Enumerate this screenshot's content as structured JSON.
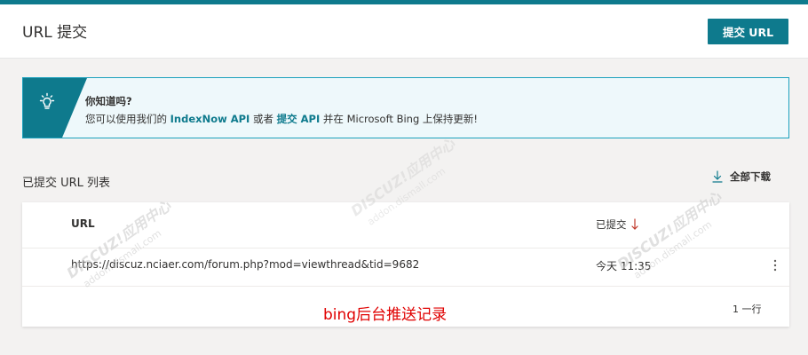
{
  "header": {
    "title": "URL 提交",
    "submit_button": "提交 URL"
  },
  "banner": {
    "title": "你知道吗?",
    "text_part1": "您可以使用我们的 ",
    "link1": "IndexNow API",
    "text_part2": " 或者 ",
    "link2": "提交 API",
    "text_part3": " 并在 Microsoft Bing 上保持更新!",
    "icon": "lightbulb-icon"
  },
  "section": {
    "title": "已提交 URL 列表",
    "download_label": "全部下载",
    "download_icon": "download-icon"
  },
  "table": {
    "headers": {
      "url": "URL",
      "submitted": "已提交"
    },
    "rows": [
      {
        "url": "https://discuz.nciaer.com/forum.php?mod=viewthread&tid=9682",
        "time": "今天 11:35"
      }
    ],
    "row_count": "1 一行"
  },
  "annotation": "bing后台推送记录",
  "watermark": "DISCUZ!应用中心 addon.dismall.com 贰道",
  "colors": {
    "accent": "#0e7a8d",
    "banner_border": "#1ba1bd",
    "banner_bg": "#eef8fb",
    "annotation": "#e00000"
  }
}
